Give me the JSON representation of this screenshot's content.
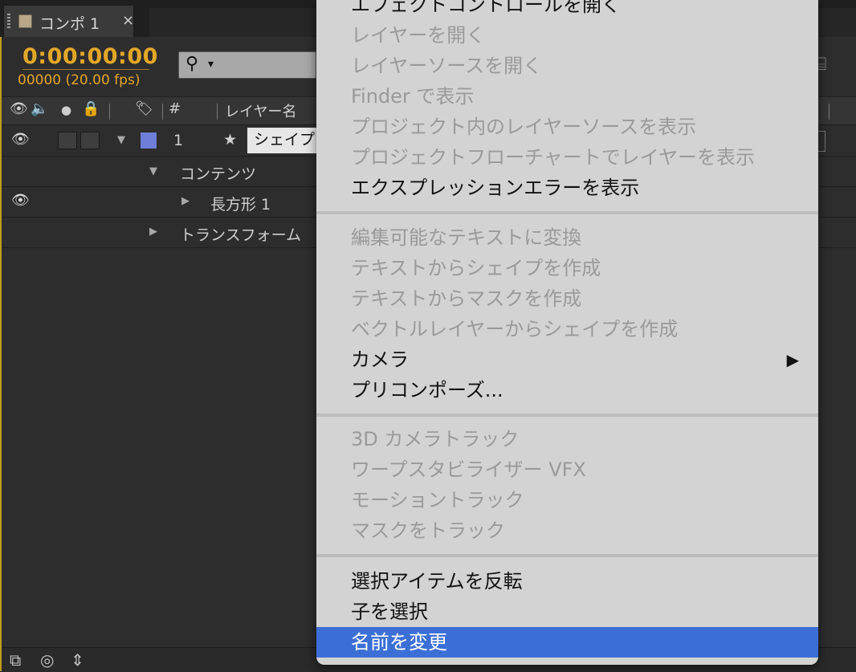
{
  "tab": {
    "label": "コンポ 1",
    "close": "×"
  },
  "timecode": "0:00:00:00",
  "fps": "00000 (20.00 fps)",
  "search": {
    "icon": "search-icon",
    "arrow": "▾"
  },
  "header": {
    "num": "#",
    "layer_name": "レイヤー名"
  },
  "rows": {
    "layer": {
      "number": "1",
      "name": "シェイプ"
    },
    "contents": "コンテンツ",
    "rect": "長方形 1",
    "transform": "トランスフォーム"
  },
  "menu": {
    "items": [
      {
        "label": "エフェクトコントロールを開く",
        "enabled": true
      },
      {
        "label": "レイヤーを開く",
        "enabled": false
      },
      {
        "label": "レイヤーソースを開く",
        "enabled": false
      },
      {
        "label": "Finder で表示",
        "enabled": false
      },
      {
        "label": "プロジェクト内のレイヤーソースを表示",
        "enabled": false
      },
      {
        "label": "プロジェクトフローチャートでレイヤーを表示",
        "enabled": false
      },
      {
        "label": "エクスプレッションエラーを表示",
        "enabled": true
      },
      {
        "label": "編集可能なテキストに変換",
        "enabled": false
      },
      {
        "label": "テキストからシェイプを作成",
        "enabled": false
      },
      {
        "label": "テキストからマスクを作成",
        "enabled": false
      },
      {
        "label": "ベクトルレイヤーからシェイプを作成",
        "enabled": false
      },
      {
        "label": "カメラ",
        "enabled": true,
        "submenu_arrow": "▶"
      },
      {
        "label": "プリコンポーズ...",
        "enabled": true
      },
      {
        "label": "3D カメラトラック",
        "enabled": false
      },
      {
        "label": "ワープスタビライザー VFX",
        "enabled": false
      },
      {
        "label": "モーショントラック",
        "enabled": false
      },
      {
        "label": "マスクをトラック",
        "enabled": false
      },
      {
        "label": "選択アイテムを反転",
        "enabled": true
      },
      {
        "label": "子を選択",
        "enabled": true
      },
      {
        "label": "名前を変更",
        "enabled": true,
        "selected": true
      }
    ]
  },
  "colors": {
    "timecode": "#e3a727",
    "selection": "#3b6fd6",
    "label_swatch": "#6f7ed8"
  }
}
